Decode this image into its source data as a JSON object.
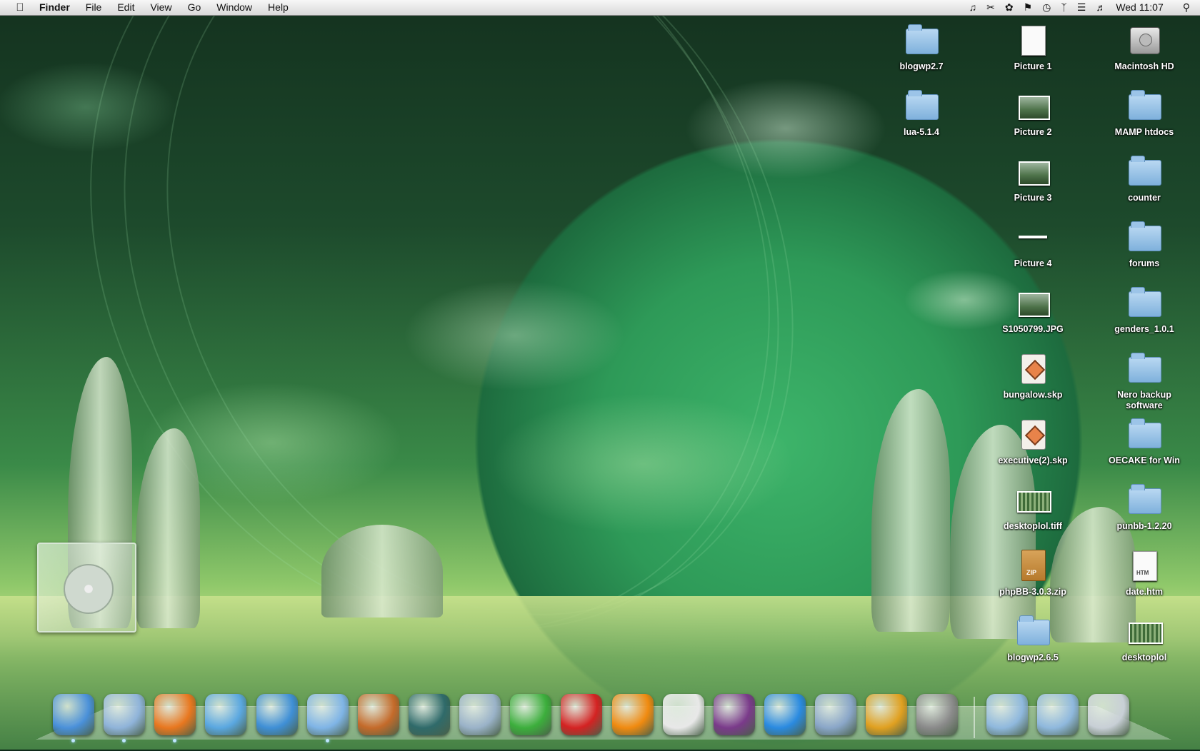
{
  "menubar": {
    "apple_icon": "apple-icon",
    "app": "Finder",
    "items": [
      "File",
      "Edit",
      "View",
      "Go",
      "Window",
      "Help"
    ],
    "status_icons": [
      "music-note-icon",
      "scissors-icon",
      "paw-icon",
      "flag-icon",
      "time-machine-icon",
      "bluetooth-icon",
      "wifi-icon",
      "volume-icon"
    ],
    "clock": "Wed 11:07",
    "spotlight_icon": "spotlight-icon"
  },
  "desktop_icons": [
    {
      "label": "blogwp2.7",
      "kind": "folder"
    },
    {
      "label": "lua-5.1.4",
      "kind": "folder"
    },
    {
      "label": "Picture 1",
      "kind": "document"
    },
    {
      "label": "Picture 2",
      "kind": "photo"
    },
    {
      "label": "Picture 3",
      "kind": "photo"
    },
    {
      "label": "Picture 4",
      "kind": "thin-image"
    },
    {
      "label": "S1050799.JPG",
      "kind": "photo"
    },
    {
      "label": "bungalow.skp",
      "kind": "sketchup"
    },
    {
      "label": "executive(2).skp",
      "kind": "sketchup"
    },
    {
      "label": "desktoplol.tiff",
      "kind": "image-strip"
    },
    {
      "label": "phpBB-3.0.3.zip",
      "kind": "zip",
      "tag": "ZIP"
    },
    {
      "label": "blogwp2.6.5",
      "kind": "folder"
    },
    {
      "label": "Macintosh HD",
      "kind": "hard-drive"
    },
    {
      "label": "MAMP htdocs",
      "kind": "folder"
    },
    {
      "label": "counter",
      "kind": "folder"
    },
    {
      "label": "forums",
      "kind": "folder"
    },
    {
      "label": "genders_1.0.1",
      "kind": "folder"
    },
    {
      "label": "Nero backup software",
      "kind": "folder"
    },
    {
      "label": "OECAKE for Win",
      "kind": "folder"
    },
    {
      "label": "punbb-1.2.20",
      "kind": "folder"
    },
    {
      "label": "date.htm",
      "kind": "document",
      "tag": "HTM"
    },
    {
      "label": "desktoplol",
      "kind": "image-strip"
    }
  ],
  "cd_widget": {
    "icon": "cd-case-icon"
  },
  "dock": {
    "apps": [
      {
        "name": "finder-icon",
        "color": "#4a90d9",
        "running": true
      },
      {
        "name": "mail-icon",
        "color": "#8fb3d9",
        "running": true
      },
      {
        "name": "firefox-icon",
        "color": "#e8771f",
        "running": true
      },
      {
        "name": "safari-icon",
        "color": "#5aa7e0",
        "running": false
      },
      {
        "name": "messenger-icon",
        "color": "#3f8fd6",
        "running": false
      },
      {
        "name": "itunes-icon",
        "color": "#7fb4e6",
        "running": true
      },
      {
        "name": "iphoto-icon",
        "color": "#c46a2a",
        "running": false
      },
      {
        "name": "time-machine-icon",
        "color": "#2f6a6a",
        "running": false
      },
      {
        "name": "newsreader-icon",
        "color": "#9ab2c8",
        "running": false
      },
      {
        "name": "xchat-icon",
        "color": "#3cae3c",
        "running": false
      },
      {
        "name": "growl-icon",
        "color": "#d42222",
        "running": false
      },
      {
        "name": "vlc-icon",
        "color": "#f08a10",
        "running": false
      },
      {
        "name": "text-window-icon",
        "color": "#e8e8e8",
        "running": false
      },
      {
        "name": "adium-icon",
        "color": "#7a3a8a",
        "running": false
      },
      {
        "name": "quicktime-icon",
        "color": "#2a8ae0",
        "running": false
      },
      {
        "name": "preview-icon",
        "color": "#8aa6c8",
        "running": false
      },
      {
        "name": "xcode-icon",
        "color": "#e0a020",
        "running": false
      },
      {
        "name": "system-preferences-icon",
        "color": "#8a8a8a",
        "running": false
      }
    ],
    "stacks": [
      {
        "name": "documents-stack-icon",
        "color": "#8fb8dd"
      },
      {
        "name": "applications-stack-icon",
        "color": "#8fb8dd"
      },
      {
        "name": "trash-icon",
        "color": "#c8cfd6"
      }
    ]
  }
}
